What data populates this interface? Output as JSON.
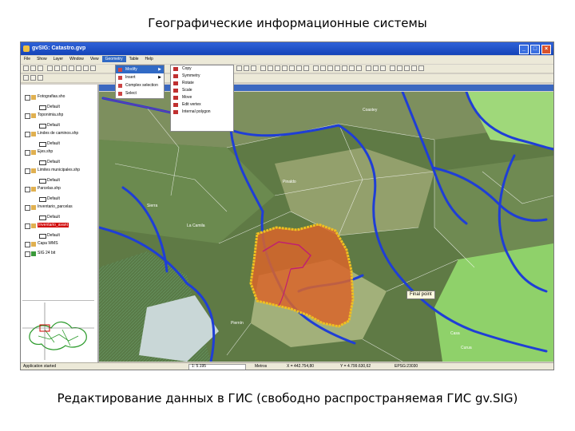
{
  "slide": {
    "title": "Географические информационные системы",
    "caption": "Редактирование данных в ГИС (свободно распространяемая ГИС gv.SIG)"
  },
  "window": {
    "title": "gvSIG: Catastro.gvp",
    "menu": [
      "File",
      "Show",
      "Layer",
      "Window",
      "View",
      "Geometry",
      "Table",
      "Help"
    ],
    "active_menu": "Geometry"
  },
  "geometry_menu": {
    "items": [
      {
        "label": "Modify",
        "has_submenu": true
      },
      {
        "label": "Insert",
        "has_submenu": true
      },
      {
        "label": "Complex selection",
        "has_submenu": false
      },
      {
        "label": "Select",
        "has_submenu": false
      }
    ]
  },
  "modify_submenu": {
    "items": [
      "Copy",
      "Symmetry",
      "Rotate",
      "Scale",
      "Move",
      "Edit vertex",
      "Internal polygon"
    ]
  },
  "view": {
    "title": "View: Inventario de Caminos"
  },
  "toc": {
    "rows": [
      {
        "type": "layer",
        "name": "Fotografias.sho"
      },
      {
        "type": "legend",
        "name": "Default"
      },
      {
        "type": "layer",
        "name": "Toponimia.shp"
      },
      {
        "type": "legend",
        "name": "Default"
      },
      {
        "type": "layer",
        "name": "Lindes de caminos.shp"
      },
      {
        "type": "legend",
        "name": "Default"
      },
      {
        "type": "layer",
        "name": "Ejes.shp"
      },
      {
        "type": "legend",
        "name": "Default"
      },
      {
        "type": "layer",
        "name": "Limites municipales.shp"
      },
      {
        "type": "legend",
        "name": "Default"
      },
      {
        "type": "layer",
        "name": "Parcelas.shp"
      },
      {
        "type": "legend",
        "name": "Default"
      },
      {
        "type": "layer",
        "name": "Inventario_parcelas"
      },
      {
        "type": "legend",
        "name": "Default"
      },
      {
        "type": "layer",
        "name": "Inventario_avant",
        "selected": true
      },
      {
        "type": "legend",
        "name": "Default"
      },
      {
        "type": "layer",
        "name": "Capa WMS"
      },
      {
        "type": "layer",
        "name": "SIG 24 bit"
      }
    ]
  },
  "map": {
    "labels": [
      "Final point",
      "Sierra",
      "Coastey",
      "Pinaldo",
      "Casa",
      "La Camila",
      "Piernín",
      "Curua"
    ]
  },
  "status": {
    "message": "Application started",
    "scale": "1: 5.195",
    "units": "Metros",
    "x": "X = 442.754,80",
    "y": "Y = 4.799.630,62",
    "epsg": "EPSG:23030"
  },
  "colors": {
    "titlebar": "#1f51c8",
    "roads": "#2040d0",
    "polygon_fill": "#d9652a",
    "polygon_border": "#f0c020"
  }
}
